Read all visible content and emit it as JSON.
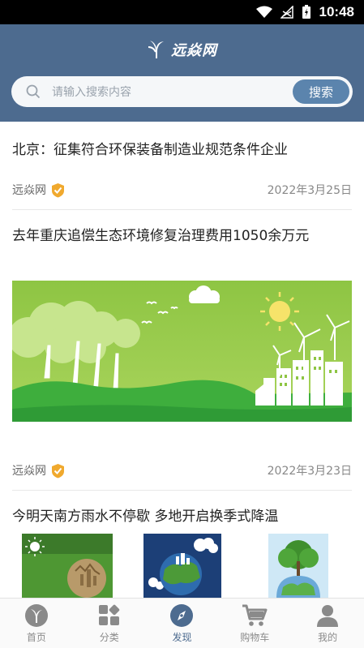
{
  "status_bar": {
    "time": "10:48"
  },
  "header": {
    "brand": "远焱网"
  },
  "search": {
    "placeholder": "请输入搜索内容",
    "button_label": "搜索"
  },
  "feed": [
    {
      "title": "北京：征集符合环保装备制造业规范条件企业",
      "source": "远焱网",
      "date": "2022年3月25日"
    },
    {
      "title": "去年重庆追偿生态环境修复治理费用1050余万元",
      "source": "远焱网",
      "date": "2022年3月23日"
    },
    {
      "title": "今明天南方雨水不停歇 多地开启换季式降温"
    }
  ],
  "tabbar": {
    "items": [
      {
        "label": "首页",
        "icon": "home-logo-icon"
      },
      {
        "label": "分类",
        "icon": "grid-icon"
      },
      {
        "label": "发现",
        "icon": "compass-icon",
        "active": true
      },
      {
        "label": "购物车",
        "icon": "cart-icon"
      },
      {
        "label": "我的",
        "icon": "user-icon"
      }
    ]
  },
  "colors": {
    "header": "#4d6b8f",
    "search_button": "#5b84ad",
    "verified": "#f0a92e",
    "active_tab": "#4d6b8f"
  }
}
